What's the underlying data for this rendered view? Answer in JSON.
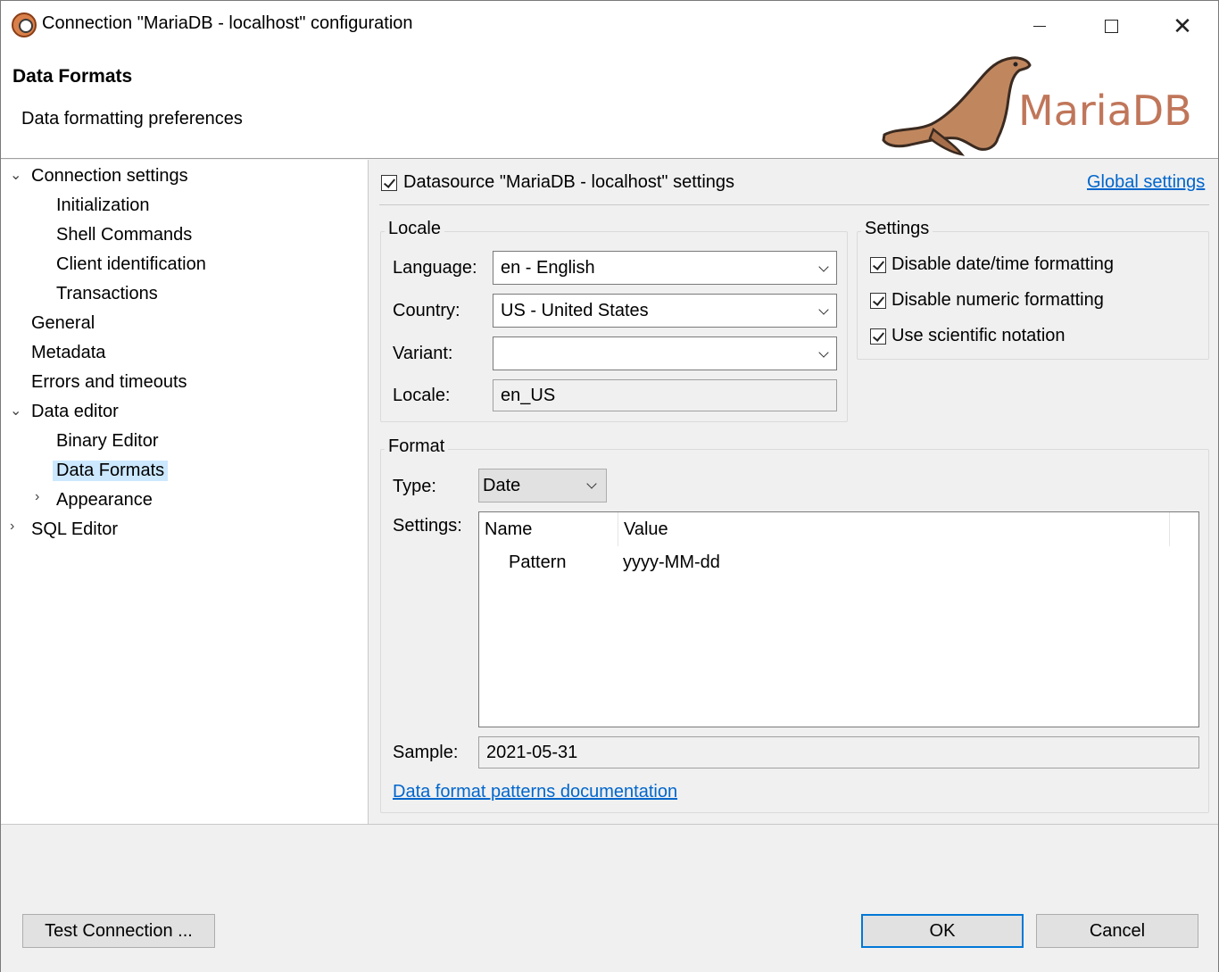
{
  "window": {
    "title": "Connection \"MariaDB - localhost\" configuration"
  },
  "header": {
    "title": "Data Formats",
    "description": "Data formatting preferences",
    "logo_text": "MariaDB"
  },
  "sidebar": {
    "items": [
      {
        "label": "Connection settings",
        "expanded": true
      },
      {
        "label": "Initialization"
      },
      {
        "label": "Shell Commands"
      },
      {
        "label": "Client identification"
      },
      {
        "label": "Transactions"
      },
      {
        "label": "General"
      },
      {
        "label": "Metadata"
      },
      {
        "label": "Errors and timeouts"
      },
      {
        "label": "Data editor",
        "expanded": true
      },
      {
        "label": "Binary Editor"
      },
      {
        "label": "Data Formats",
        "selected": true
      },
      {
        "label": "Appearance",
        "expanded": false
      },
      {
        "label": "SQL Editor",
        "expanded": false
      }
    ]
  },
  "datasource": {
    "checkbox_label": "Datasource \"MariaDB - localhost\" settings",
    "checked": true,
    "global_link": "Global settings"
  },
  "locale": {
    "group_label": "Locale",
    "language_label": "Language:",
    "language_value": "en - English",
    "country_label": "Country:",
    "country_value": "US - United States",
    "variant_label": "Variant:",
    "variant_value": "",
    "locale_label": "Locale:",
    "locale_value": "en_US"
  },
  "settings": {
    "group_label": "Settings",
    "options": [
      {
        "label": "Disable date/time formatting",
        "checked": true
      },
      {
        "label": "Disable numeric formatting",
        "checked": true
      },
      {
        "label": "Use scientific notation",
        "checked": true
      }
    ]
  },
  "format": {
    "group_label": "Format",
    "type_label": "Type:",
    "type_value": "Date",
    "settings_label": "Settings:",
    "columns": [
      "Name",
      "Value"
    ],
    "rows": [
      {
        "name": "Pattern",
        "value": "yyyy-MM-dd"
      }
    ],
    "sample_label": "Sample:",
    "sample_value": "2021-05-31",
    "docs_link": "Data format patterns documentation"
  },
  "footer": {
    "test_connection_label": "Test Connection ...",
    "ok_label": "OK",
    "cancel_label": "Cancel"
  }
}
